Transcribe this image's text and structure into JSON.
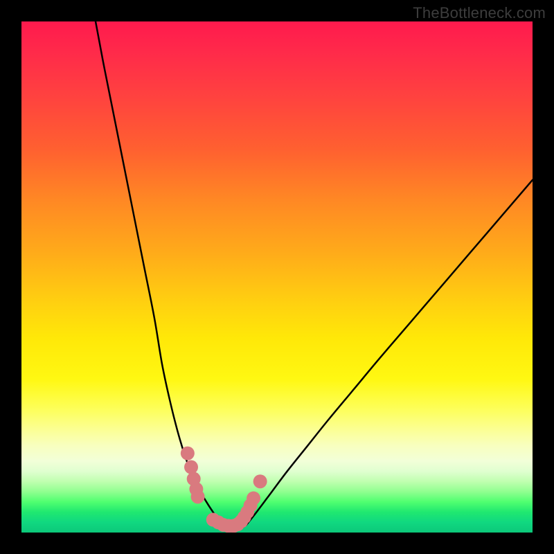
{
  "watermark": "TheBottleneck.com",
  "chart_data": {
    "type": "line",
    "title": "",
    "xlabel": "",
    "ylabel": "",
    "xlim": [
      0,
      100
    ],
    "ylim": [
      0,
      100
    ],
    "background": "rainbow-gradient-vertical",
    "series": [
      {
        "name": "bottleneck-curve-left",
        "x": [
          14.5,
          16,
          18,
          20,
          22,
          24,
          26,
          27.5,
          29,
          30.5,
          32,
          33.5,
          35,
          36.5,
          37.8,
          39
        ],
        "values": [
          100,
          92,
          82,
          72,
          62,
          52,
          42,
          33,
          26,
          20,
          15,
          11,
          8,
          5.5,
          3.5,
          1.5
        ]
      },
      {
        "name": "bottleneck-valley",
        "x": [
          39,
          40,
          41,
          42,
          43,
          44
        ],
        "values": [
          1.5,
          0.8,
          0.5,
          0.5,
          0.8,
          1.5
        ]
      },
      {
        "name": "bottleneck-curve-right",
        "x": [
          44,
          46,
          49,
          52,
          56,
          60,
          65,
          70,
          76,
          82,
          88,
          94,
          100
        ],
        "values": [
          1.5,
          4,
          8,
          12,
          17,
          22,
          28,
          34,
          41,
          48,
          55,
          62,
          69
        ]
      }
    ],
    "markers": {
      "name": "highlighted-points",
      "color": "#d97a7f",
      "points": [
        {
          "x": 32.5,
          "y": 15.5
        },
        {
          "x": 33.2,
          "y": 12.8
        },
        {
          "x": 33.7,
          "y": 10.5
        },
        {
          "x": 34.2,
          "y": 8.5
        },
        {
          "x": 34.5,
          "y": 7.0
        },
        {
          "x": 37.5,
          "y": 2.5
        },
        {
          "x": 38.5,
          "y": 2.0
        },
        {
          "x": 39.5,
          "y": 1.5
        },
        {
          "x": 40.5,
          "y": 1.3
        },
        {
          "x": 41.5,
          "y": 1.3
        },
        {
          "x": 42.3,
          "y": 1.6
        },
        {
          "x": 43.0,
          "y": 2.2
        },
        {
          "x": 43.6,
          "y": 3.0
        },
        {
          "x": 44.2,
          "y": 4.0
        },
        {
          "x": 44.8,
          "y": 5.3
        },
        {
          "x": 45.4,
          "y": 6.7
        },
        {
          "x": 46.7,
          "y": 10.0
        }
      ]
    }
  }
}
